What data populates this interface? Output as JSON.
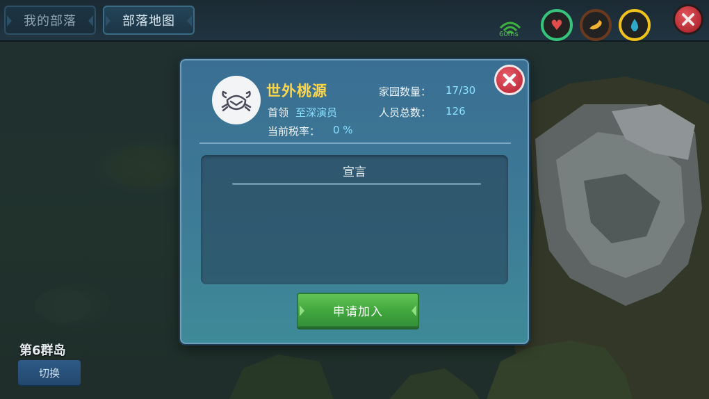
{
  "tabs": [
    {
      "label": "我的部落",
      "active": false
    },
    {
      "label": "部落地图",
      "active": true
    }
  ],
  "status": {
    "ping": "60ms",
    "icons": [
      "wifi-icon",
      "heart-icon",
      "food-icon",
      "water-icon",
      "close-icon"
    ]
  },
  "map": {
    "island_label": "第6群岛",
    "switch_label": "切换"
  },
  "dialog": {
    "tribe_name": "世外桃源",
    "leader_label": "首领",
    "leader_name": "至深演员",
    "tax_label": "当前税率：",
    "tax_value": "0 %",
    "homes_label": "家园数量：",
    "homes_value": "17/30",
    "members_label": "人员总数：",
    "members_value": "126",
    "declaration_title": "宣言",
    "join_label": "申请加入",
    "emblem_icon": "crab-icon"
  },
  "colors": {
    "tribe_name": "#ffd64a",
    "value_text": "#8ae0ff",
    "join_button": "#4bb145",
    "close_button": "#c33141"
  }
}
